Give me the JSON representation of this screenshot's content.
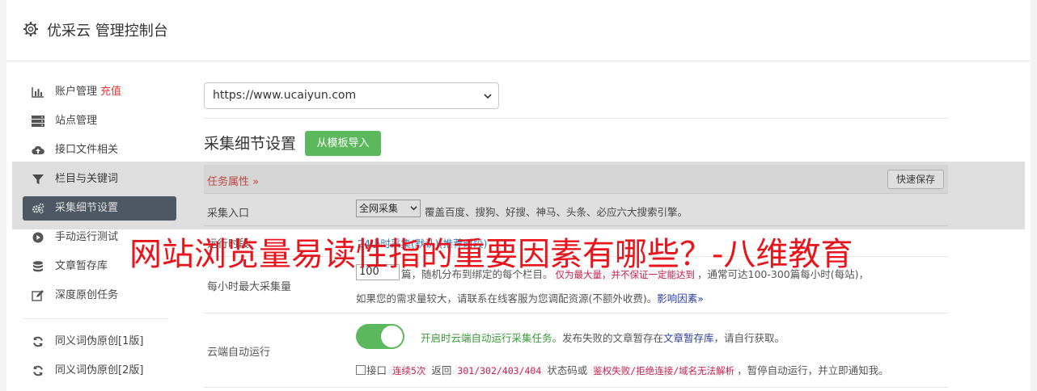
{
  "header": {
    "title": "优采云 管理控制台",
    "icon": "gear-icon"
  },
  "sidebar": {
    "items": [
      {
        "label": "账户管理",
        "badge": "充值",
        "icon": "bar-chart-icon"
      },
      {
        "label": "站点管理",
        "icon": "server-icon"
      },
      {
        "label": "接口文件相关",
        "icon": "cloud-upload-icon"
      },
      {
        "label": "栏目与关键词",
        "icon": "filter-icon"
      },
      {
        "label": "采集细节设置",
        "icon": "gears-icon",
        "active": true
      },
      {
        "label": "手动运行测试",
        "icon": "play-circle-icon"
      },
      {
        "label": "文章暂存库",
        "icon": "database-icon"
      },
      {
        "label": "深度原创任务",
        "icon": "edit-icon"
      },
      {
        "label": "同义词伪原创[1版]",
        "icon": "refresh-icon"
      },
      {
        "label": "同义词伪原创[2版]",
        "icon": "refresh-icon"
      }
    ]
  },
  "main": {
    "site_select": {
      "value": "https://www.ucaiyun.com"
    },
    "section_title": "采集细节设置",
    "import_button": "从模板导入",
    "task_props": "任务属性 »",
    "quick_save": "快速保存",
    "collect_entry": {
      "label": "采集入口",
      "select_value": "全网采集",
      "desc": "覆盖百度、搜狗、好搜、神马、头条、必应六大搜索引擎。"
    },
    "hidden_row": {
      "label": "运行时段",
      "desc": "24小时采集(默认)(推荐时段)"
    },
    "max_per_hour": {
      "label": "每小时最大采集量",
      "value": "100",
      "text1": "篇，随机分布到绑定的每个栏目。",
      "code1": "仅为最大量，并不保证一定能达到",
      "text2": "，通常可达100-300篇每小时(每站)，",
      "text3": "如果您的需求量较大，请联系在线客服为您调配资源(不额外收费)。",
      "link": "影响因素»"
    },
    "cloud_auto": {
      "label": "云端自动运行",
      "toggle_on": true,
      "green_text": "开启时云端自动运行采集任务。",
      "text1": "发布失败的文章暂存在",
      "link": "文章暂存库",
      "text2": "，请自行获取。",
      "chk_label": "接口",
      "code1": "连续5次",
      "text3": "返回",
      "code2": "301/302/403/404",
      "text4": "状态码或",
      "code3": "鉴权失败/拒绝连接/域名无法解析",
      "text5": "，暂停自动运行，并立即通知我。"
    }
  },
  "watermark": "网站浏览量易读性指的重要因素有哪些？-八维教育",
  "colors": {
    "accent_green": "#5cb85c",
    "active_nav": "#5a6473",
    "watermark_red": "#e8141b"
  }
}
